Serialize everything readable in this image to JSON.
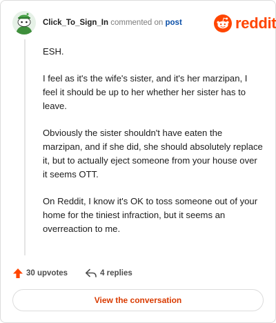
{
  "header": {
    "username": "Click_To_Sign_In",
    "action": "commented on",
    "post_link": "post",
    "logo_word": "reddit"
  },
  "comment": {
    "paragraphs": [
      "ESH.",
      "I feel as it's the wife's sister, and it's her marzipan, I feel it should be up to her whether her sister has to leave.",
      "Obviously the sister shouldn't have eaten the marzipan, and if she did, she should absolutely replace it, but to actually eject someone from your house over it seems OTT.",
      "On Reddit, I know it's OK to toss someone out of your home for the tiniest infraction, but it seems an overreaction to me."
    ]
  },
  "footer": {
    "upvotes": "30 upvotes",
    "replies": "4 replies"
  },
  "cta": {
    "label": "View the conversation"
  },
  "colors": {
    "brand": "#ff4500",
    "link": "#0a4fa8",
    "cta_text": "#d93a00"
  },
  "icons": {
    "avatar": "snoo-avatar-icon",
    "logo": "reddit-snoo-logo-icon",
    "upvote": "upvote-arrow-icon",
    "reply": "reply-arrow-icon"
  }
}
